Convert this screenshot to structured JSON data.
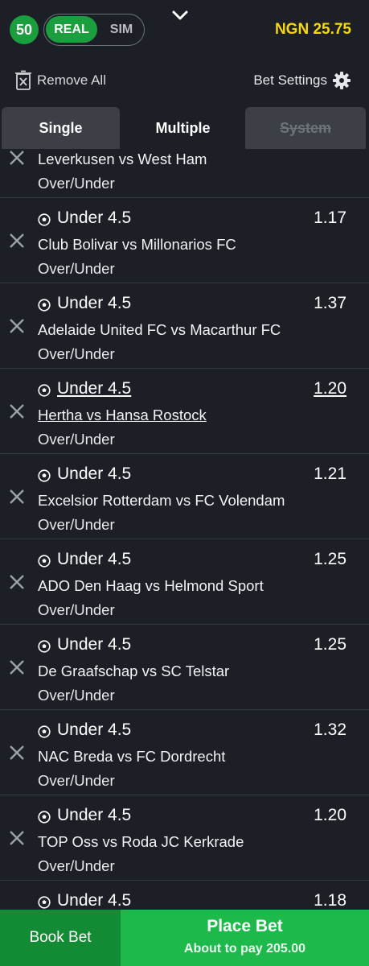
{
  "header": {
    "selection_count": "50",
    "mode_real": "REAL",
    "mode_sim": "SIM",
    "balance": "NGN 25.75",
    "collapse_icon": "chevron-down-icon"
  },
  "actions": {
    "remove_all": "Remove All",
    "bet_settings": "Bet Settings"
  },
  "tabs": [
    {
      "label": "Single",
      "active": false
    },
    {
      "label": "Multiple",
      "active": true
    },
    {
      "label": "System",
      "active": false,
      "disabled": true
    }
  ],
  "bets": [
    {
      "selection": "",
      "odds": "",
      "match": "Leverkusen vs West Ham",
      "market": "Over/Under"
    },
    {
      "selection": "Under 4.5",
      "odds": "1.17",
      "match": "Club Bolivar vs Millonarios FC",
      "market": "Over/Under"
    },
    {
      "selection": "Under 4.5",
      "odds": "1.37",
      "match": "Adelaide United FC vs Macarthur FC",
      "market": "Over/Under"
    },
    {
      "selection": "Under 4.5",
      "odds": "1.20",
      "match": "Hertha vs Hansa Rostock",
      "market": "Over/Under",
      "underlined": true
    },
    {
      "selection": "Under 4.5",
      "odds": "1.21",
      "match": "Excelsior Rotterdam vs FC Volendam",
      "market": "Over/Under"
    },
    {
      "selection": "Under 4.5",
      "odds": "1.25",
      "match": "ADO Den Haag vs Helmond Sport",
      "market": "Over/Under"
    },
    {
      "selection": "Under 4.5",
      "odds": "1.25",
      "match": "De Graafschap vs SC Telstar",
      "market": "Over/Under"
    },
    {
      "selection": "Under 4.5",
      "odds": "1.32",
      "match": "NAC Breda vs FC Dordrecht",
      "market": "Over/Under"
    },
    {
      "selection": "Under 4.5",
      "odds": "1.20",
      "match": "TOP Oss vs Roda JC Kerkrade",
      "market": "Over/Under"
    },
    {
      "selection": "Under 4.5",
      "odds": "1.18",
      "match": "",
      "market": ""
    }
  ],
  "footer": {
    "book_bet": "Book Bet",
    "place_bet": "Place Bet",
    "pay_text": "About to pay 205.00"
  },
  "colors": {
    "background": "#1c1f26",
    "accent_green": "#1db94b",
    "dark_green": "#138a34",
    "balance_yellow": "#f5d90a"
  }
}
